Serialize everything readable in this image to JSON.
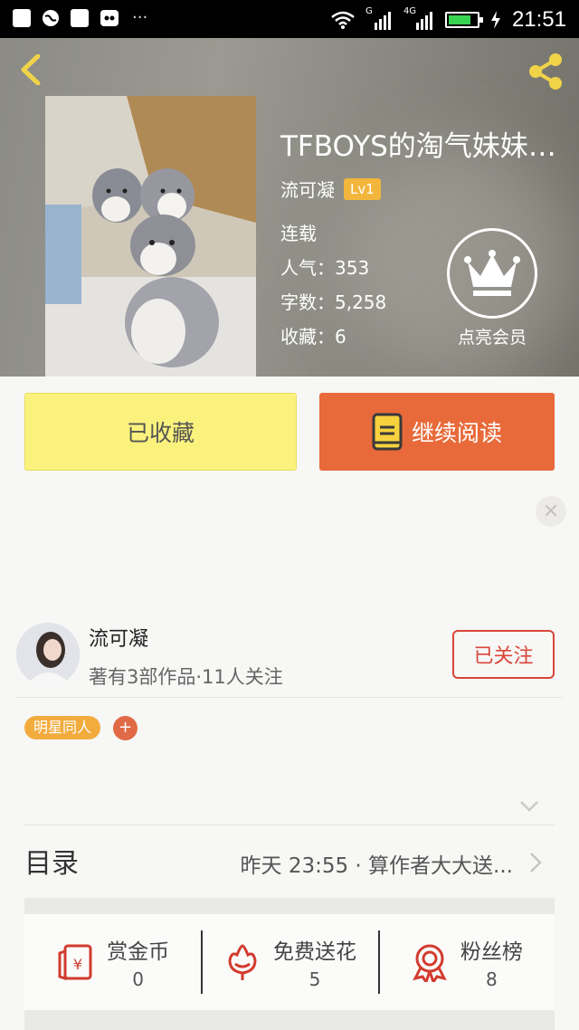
{
  "status_bar": {
    "time": "21:51",
    "network_1": "G",
    "network_2": "4G"
  },
  "book": {
    "title": "TFBOYS的淘气妹妹第...",
    "author": "流可凝",
    "level": "Lv1",
    "status": "连载",
    "popularity_label": "人气：",
    "popularity": "353",
    "words_label": "字数：",
    "words": "5,258",
    "favorites_label": "收藏：",
    "favorites": "6"
  },
  "vip": {
    "label": "点亮会员"
  },
  "actions": {
    "collected_label": "已收藏",
    "read_label": "继续阅读"
  },
  "author_card": {
    "name": "流可凝",
    "subtitle": "著有3部作品·11人关注",
    "follow_label": "已关注"
  },
  "tags": [
    {
      "label": "明星同人"
    }
  ],
  "tag_add": "+",
  "toc": {
    "label": "目录",
    "latest": "昨天 23:55 · 算作者大大送..."
  },
  "stats": [
    {
      "label": "赏金币",
      "value": "0",
      "icon": "red-envelope-icon"
    },
    {
      "label": "免费送花",
      "value": "5",
      "icon": "flower-icon"
    },
    {
      "label": "粉丝榜",
      "value": "8",
      "icon": "rosette-icon"
    }
  ],
  "colors": {
    "collected_bg": "#fbf27d",
    "read_bg": "#e86a3a",
    "follow_accent": "#d9463a",
    "tag_bg": "#f2ac3e",
    "level_bg": "#f2b63c",
    "stat_icon": "#d23b2e"
  }
}
